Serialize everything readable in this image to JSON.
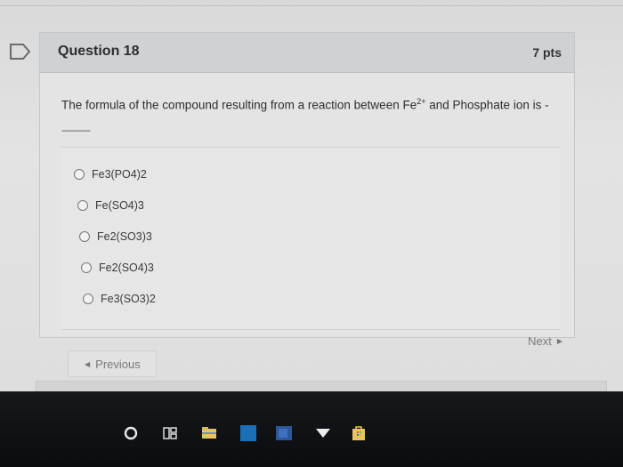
{
  "question": {
    "title": "Question 18",
    "points": "7 pts",
    "text_before": "The formula of the compound resulting from a reaction between Fe",
    "superscript": "2+",
    "text_after": " and Phosphate ion is -",
    "blank": "------------"
  },
  "answers": [
    {
      "label": "Fe3(PO4)2"
    },
    {
      "label": "Fe(SO4)3"
    },
    {
      "label": "Fe2(SO3)3"
    },
    {
      "label": "Fe2(SO4)3"
    },
    {
      "label": "Fe3(SO3)2"
    }
  ],
  "navigation": {
    "previous_label": "Previous",
    "next_label": "Next"
  },
  "taskbar": {
    "icons": [
      "cortana-icon",
      "task-view-icon",
      "file-explorer-icon",
      "edge-icon",
      "word-icon",
      "media-icon",
      "store-icon"
    ]
  }
}
